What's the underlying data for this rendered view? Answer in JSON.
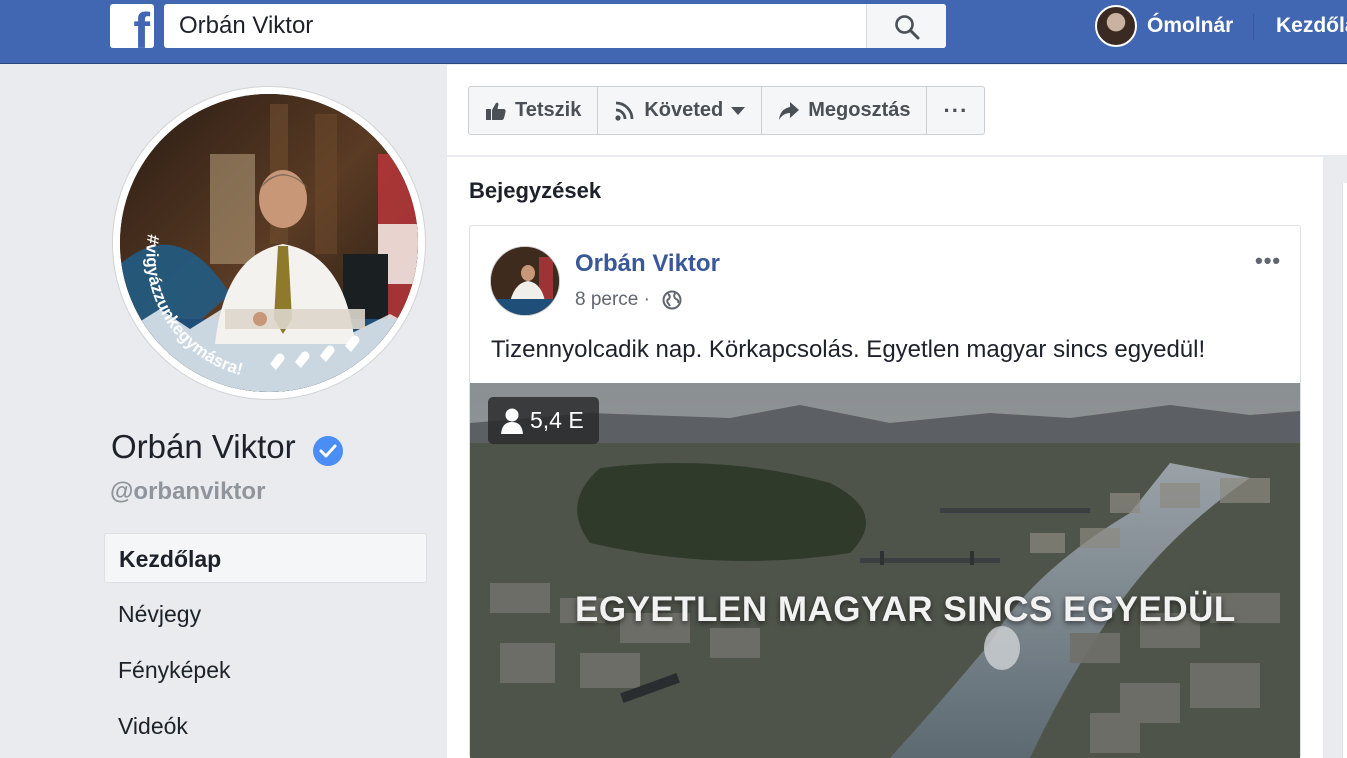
{
  "topbar": {
    "logo": "f",
    "search_value": "Orbán Viktor",
    "search_icon": "search-icon",
    "user_name": "Ómolnár",
    "home_link": "Kezdőlap"
  },
  "profile": {
    "name": "Orbán Viktor",
    "username": "@orbanviktor",
    "hashtag": "#vigyázzunkegymásra!",
    "verified_color": "#4a8ef5"
  },
  "nav": {
    "items": [
      "Kezdőlap",
      "Névjegy",
      "Fényképek",
      "Videók"
    ]
  },
  "actions": {
    "like": "Tetszik",
    "follow": "Követed",
    "share": "Megosztás",
    "more": "···"
  },
  "posts": {
    "title": "Bejegyzések",
    "post": {
      "author": "Orbán Viktor",
      "time": "8 perce ·",
      "menu": "•••",
      "text": "Tizennyolcadik nap. Körkapcsolás. Egyetlen magyar sincs egyedül!",
      "views": "5,4 E",
      "video_caption": "EGYETLEN MAGYAR SINCS EGYEDÜL"
    }
  },
  "colors": {
    "brand": "#4267b2",
    "link": "#385898"
  }
}
